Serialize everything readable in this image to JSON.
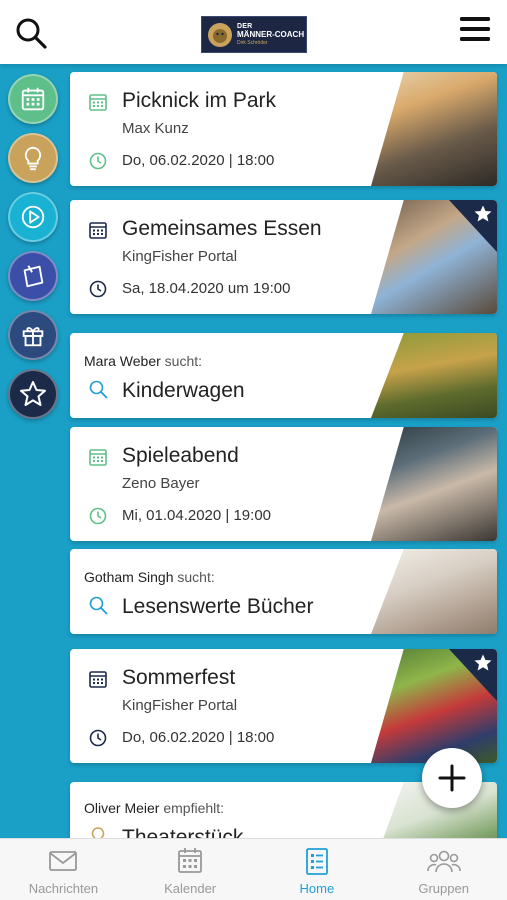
{
  "header": {
    "logo_line1": "DER",
    "logo_line2": "MÄNNER-COACH",
    "logo_line3": "Dirk Schröder"
  },
  "rail": {
    "items": [
      {
        "icon": "calendar-icon",
        "color": "#5fbf8a"
      },
      {
        "icon": "lightbulb-icon",
        "color": "#c9a35c"
      },
      {
        "icon": "play-icon",
        "color": "#19b2d2"
      },
      {
        "icon": "note-icon",
        "color": "#3b4fa8"
      },
      {
        "icon": "gift-icon",
        "color": "#2d4a7e"
      },
      {
        "icon": "star-icon",
        "color": "#1c2a4a"
      }
    ]
  },
  "cards": [
    {
      "type": "event",
      "title": "Picknick im Park",
      "subtitle": "Max Kunz",
      "date": "Do, 06.02.2020 | 18:00",
      "icon_color": "#5fbf8a",
      "featured": false
    },
    {
      "type": "event",
      "title": "Gemeinsames Essen",
      "subtitle": "KingFisher Portal",
      "date": "Sa, 18.04.2020 um 19:00",
      "icon_color": "#1c2a4a",
      "featured": true
    },
    {
      "type": "search",
      "owner": "Mara Weber",
      "verb": "sucht:",
      "term": "Kinderwagen"
    },
    {
      "type": "event",
      "title": "Spieleabend",
      "subtitle": "Zeno Bayer",
      "date": "Mi, 01.04.2020 | 19:00",
      "icon_color": "#5fbf8a",
      "featured": false
    },
    {
      "type": "search",
      "owner": "Gotham Singh",
      "verb": "sucht:",
      "term": "Lesenswerte Bücher"
    },
    {
      "type": "event",
      "title": "Sommerfest",
      "subtitle": "KingFisher Portal",
      "date": "Do, 06.02.2020 | 18:00",
      "icon_color": "#1c2a4a",
      "featured": true
    },
    {
      "type": "recommend",
      "owner": "Oliver Meier",
      "verb": "empfiehlt:",
      "term": "Theaterstück"
    }
  ],
  "bottom_nav": [
    {
      "label": "Nachrichten",
      "icon": "envelope-icon",
      "active": false
    },
    {
      "label": "Kalender",
      "icon": "calendar-icon",
      "active": false
    },
    {
      "label": "Home",
      "icon": "list-icon",
      "active": true
    },
    {
      "label": "Gruppen",
      "icon": "group-icon",
      "active": false
    }
  ],
  "colors": {
    "background": "#1aa0c7",
    "active_nav": "#1f9ed9",
    "green_icon": "#5fbf8a",
    "navy_icon": "#1c2a4a"
  }
}
